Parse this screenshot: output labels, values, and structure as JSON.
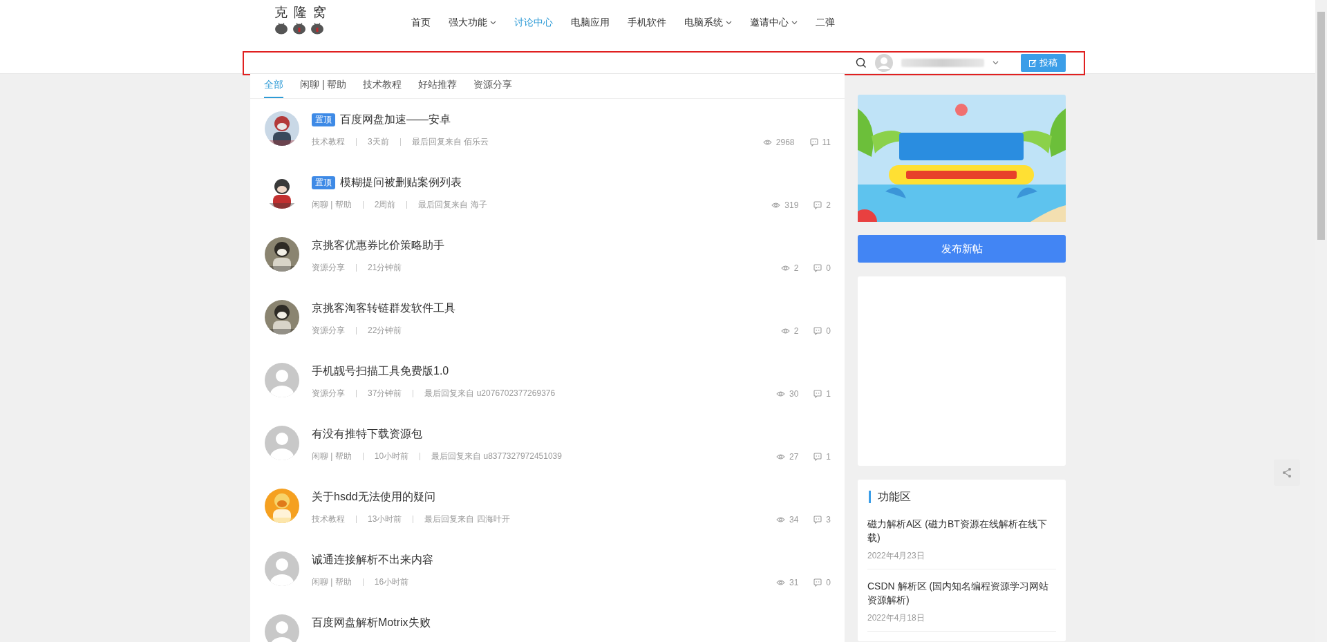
{
  "logo": {
    "text": "克 隆 窝"
  },
  "nav": [
    {
      "label": "首页",
      "has_menu": false,
      "selected": false
    },
    {
      "label": "强大功能",
      "has_menu": true,
      "selected": false
    },
    {
      "label": "讨论中心",
      "has_menu": false,
      "selected": true
    },
    {
      "label": "电脑应用",
      "has_menu": false,
      "selected": false
    },
    {
      "label": "手机软件",
      "has_menu": false,
      "selected": false
    },
    {
      "label": "电脑系统",
      "has_menu": true,
      "selected": false
    },
    {
      "label": "邀请中心",
      "has_menu": true,
      "selected": false
    },
    {
      "label": "二弹",
      "has_menu": false,
      "selected": false
    }
  ],
  "toolbar": {
    "post_button": "投稿"
  },
  "tabs": [
    {
      "label": "全部",
      "selected": true
    },
    {
      "label": "闲聊 | 帮助",
      "selected": false
    },
    {
      "label": "技术教程",
      "selected": false
    },
    {
      "label": "好站推荐",
      "selected": false
    },
    {
      "label": "资源分享",
      "selected": false
    }
  ],
  "threads": [
    {
      "badge": "置顶",
      "title": "百度网盘加速——安卓",
      "category": "技术教程",
      "time": "3天前",
      "last_reply": "最后回复来自 佰乐云",
      "views": "2968",
      "comments": "11"
    },
    {
      "badge": "置顶",
      "title": "模糊提问被删贴案例列表",
      "category": "闲聊 | 帮助",
      "time": "2周前",
      "last_reply": "最后回复来自 海子",
      "views": "319",
      "comments": "2"
    },
    {
      "title": "京挑客优惠券比价策略助手",
      "category": "资源分享",
      "time": "21分钟前",
      "views": "2",
      "comments": "0"
    },
    {
      "title": "京挑客淘客转链群发软件工具",
      "category": "资源分享",
      "time": "22分钟前",
      "views": "2",
      "comments": "0"
    },
    {
      "avatar": {
        "kind": "default"
      },
      "title": "手机靓号扫描工具免费版1.0",
      "category": "资源分享",
      "time": "37分钟前",
      "last_reply": "最后回复来自 u2076702377269376",
      "views": "30",
      "comments": "1"
    },
    {
      "avatar": {
        "kind": "default"
      },
      "title": "有没有推特下载资源包",
      "category": "闲聊 | 帮助",
      "time": "10小时前",
      "last_reply": "最后回复来自 u8377327972451039",
      "views": "27",
      "comments": "1"
    },
    {
      "title": "关于hsdd无法使用的疑问",
      "category": "技术教程",
      "time": "13小时前",
      "last_reply": "最后回复来自 四海叶开",
      "views": "34",
      "comments": "3"
    },
    {
      "avatar": {
        "kind": "default"
      },
      "title": "诚通连接解析不出来内容",
      "category": "闲聊 | 帮助",
      "time": "16小时前",
      "views": "31",
      "comments": "0"
    },
    {
      "avatar": {
        "kind": "default"
      },
      "title": "百度网盘解析Motrix失败"
    }
  ],
  "sidebar": {
    "new_post_button": "发布新帖",
    "feature_card": {
      "title": "功能区",
      "items": [
        {
          "title": "磁力解析A区 (磁力BT资源在线解析在线下载)",
          "date": "2022年4月23日"
        },
        {
          "title": "CSDN 解析区 (国内知名编程资源学习网站资源解析)",
          "date": "2022年4月18日"
        }
      ]
    }
  }
}
